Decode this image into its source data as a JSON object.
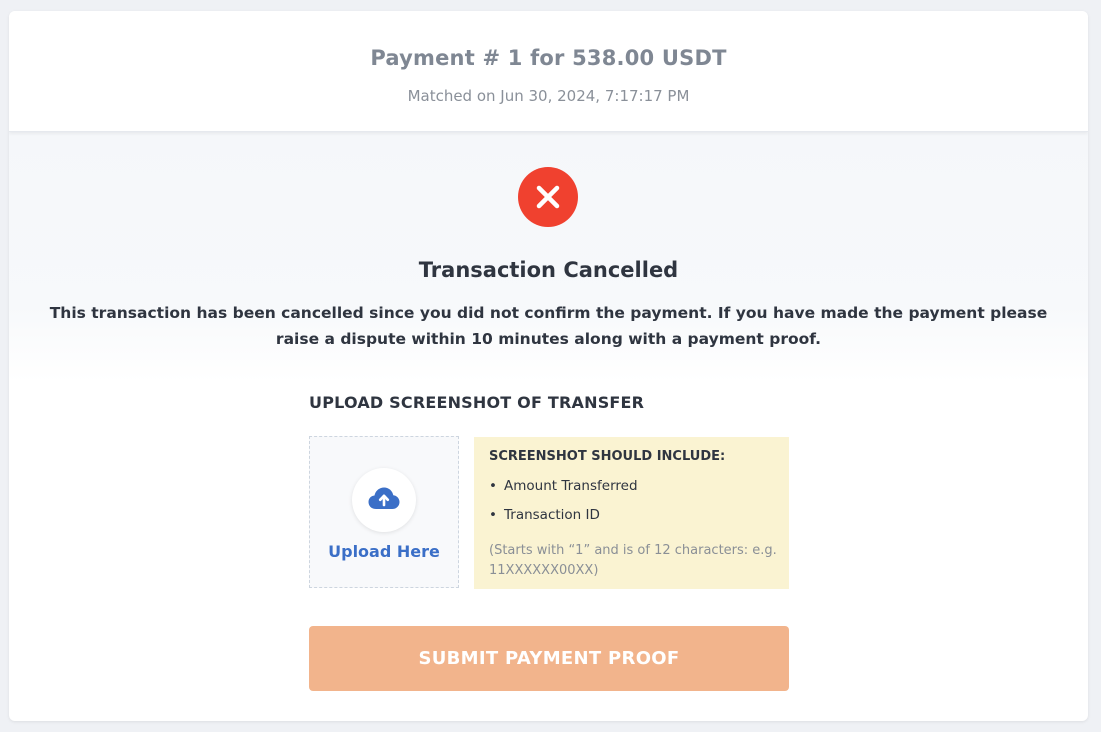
{
  "header": {
    "title": "Payment # 1 for 538.00 USDT",
    "matched": "Matched on Jun 30, 2024, 7:17:17 PM"
  },
  "status": {
    "icon": "close-circle-icon",
    "title": "Transaction Cancelled",
    "message": "This transaction has been cancelled since you did not confirm the payment. If you have made the payment please raise a dispute within 10 minutes along with a payment proof.",
    "color": "#f0412f"
  },
  "upload": {
    "heading": "UPLOAD SCREENSHOT OF TRANSFER",
    "icon": "cloud-upload-icon",
    "label": "Upload Here",
    "accent": "#3b6fc7"
  },
  "tips": {
    "heading": "SCREENSHOT SHOULD INCLUDE:",
    "items": [
      "Amount Transferred",
      "Transaction ID"
    ],
    "note": "(Starts with “1” and is of 12 characters: e.g. 11XXXXXX00XX)"
  },
  "submit": {
    "label": "SUBMIT PAYMENT PROOF",
    "color": "#f2b48c"
  }
}
